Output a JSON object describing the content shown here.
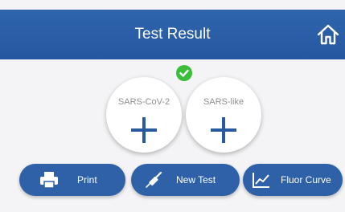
{
  "header": {
    "title": "Test Result",
    "home_icon": "home-icon"
  },
  "status": {
    "icon": "check-icon",
    "color": "#3bbf3b"
  },
  "results": [
    {
      "label": "SARS-CoV-2",
      "result_icon": "plus-icon"
    },
    {
      "label": "SARS-like",
      "result_icon": "plus-icon"
    }
  ],
  "actions": {
    "print_label": "Print",
    "new_test_label": "New Test",
    "fluor_curve_label": "Fluor Curve"
  },
  "colors": {
    "header": "#2f65ad",
    "button": "#2e61a8",
    "plus": "#2a5a9e",
    "background": "#f4f4f6"
  }
}
